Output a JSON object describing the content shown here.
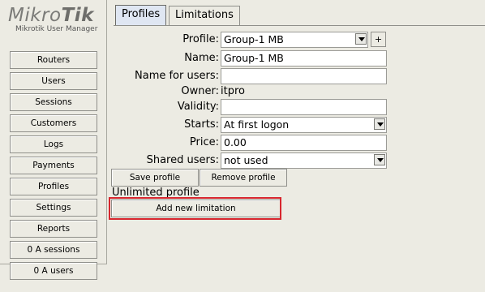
{
  "logo": {
    "brand_left": "Mikro",
    "brand_right": "Tik",
    "subtitle": "Mikrotik User Manager"
  },
  "sidebar": {
    "items": [
      {
        "label": "Routers"
      },
      {
        "label": "Users"
      },
      {
        "label": "Sessions"
      },
      {
        "label": "Customers"
      },
      {
        "label": "Logs"
      },
      {
        "label": "Payments"
      },
      {
        "label": "Profiles"
      },
      {
        "label": "Settings"
      },
      {
        "label": "Reports"
      },
      {
        "label": "0 A sessions"
      },
      {
        "label": "0 A users"
      }
    ]
  },
  "tabs": [
    {
      "label": "Profiles",
      "active": true
    },
    {
      "label": "Limitations",
      "active": false
    }
  ],
  "form": {
    "profile": {
      "label": "Profile:",
      "value": "Group-1 MB"
    },
    "add_profile_label": "+",
    "name": {
      "label": "Name:",
      "value": "Group-1 MB"
    },
    "name_for_users": {
      "label": "Name for users:",
      "value": ""
    },
    "owner": {
      "label": "Owner:",
      "value": "itpro"
    },
    "validity": {
      "label": "Validity:",
      "value": ""
    },
    "starts": {
      "label": "Starts:",
      "value": "At first logon"
    },
    "price": {
      "label": "Price:",
      "value": "0.00"
    },
    "shared_users": {
      "label": "Shared users:",
      "value": "not used"
    }
  },
  "actions": {
    "save_profile": "Save profile",
    "remove_profile": "Remove profile"
  },
  "limitations": {
    "unlimited_text": "Unlimited profile",
    "add_new_label": "Add new limitation",
    "highlight_color": "#d7262e"
  }
}
